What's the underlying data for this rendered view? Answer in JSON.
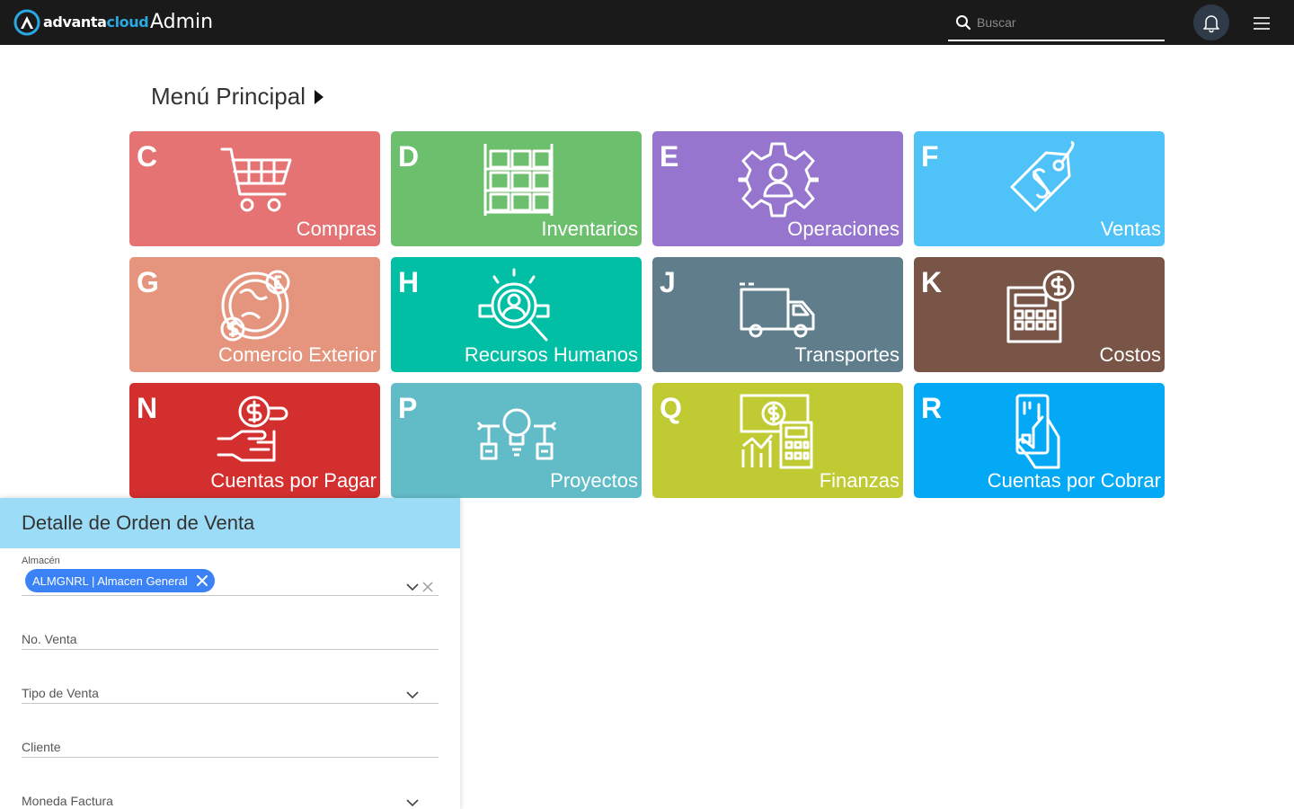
{
  "header": {
    "brand_part1": "advanta",
    "brand_part2": "cloud",
    "app_title": "Admin",
    "search_placeholder": "Buscar"
  },
  "main": {
    "title": "Menú Principal",
    "tiles": [
      {
        "key": "C",
        "label": "Compras",
        "color": "#e57373",
        "icon": "shopping-cart-icon"
      },
      {
        "key": "D",
        "label": "Inventarios",
        "color": "#6cbf6c",
        "icon": "boxes-shelf-icon"
      },
      {
        "key": "E",
        "label": "Operaciones",
        "color": "#9575cd",
        "icon": "gear-person-icon"
      },
      {
        "key": "F",
        "label": "Ventas",
        "color": "#4fc3f7",
        "icon": "price-tag-icon"
      },
      {
        "key": "G",
        "label": "Comercio Exterior",
        "color": "#e5957d",
        "icon": "globe-currency-icon"
      },
      {
        "key": "H",
        "label": "Recursos Humanos",
        "color": "#00bfa5",
        "icon": "person-search-icon"
      },
      {
        "key": "J",
        "label": "Transportes",
        "color": "#607d8b",
        "icon": "truck-icon"
      },
      {
        "key": "K",
        "label": "Costos",
        "color": "#795548",
        "icon": "calculator-coin-icon"
      },
      {
        "key": "N",
        "label": "Cuentas por Pagar",
        "color": "#d32f2f",
        "icon": "hand-coin-icon"
      },
      {
        "key": "P",
        "label": "Proyectos",
        "color": "#62bcc8",
        "icon": "lightbulb-project-icon"
      },
      {
        "key": "Q",
        "label": "Finanzas",
        "color": "#c0ca33",
        "icon": "finance-chart-icon"
      },
      {
        "key": "R",
        "label": "Cuentas por Cobrar",
        "color": "#03a9f4",
        "icon": "hand-card-icon"
      }
    ]
  },
  "form": {
    "title": "Detalle de Orden de Venta",
    "almacen_label": "Almacén",
    "almacen_value": "ALMGNRL | Almacen General",
    "no_venta_label": "No. Venta",
    "tipo_venta_label": "Tipo de Venta",
    "cliente_label": "Cliente",
    "moneda_label": "Moneda Factura"
  },
  "colors": {
    "topbar": "#1a1a1a",
    "accent": "#29a9e1",
    "panel_header": "#9ddcf6",
    "chip": "#3b82f6"
  }
}
